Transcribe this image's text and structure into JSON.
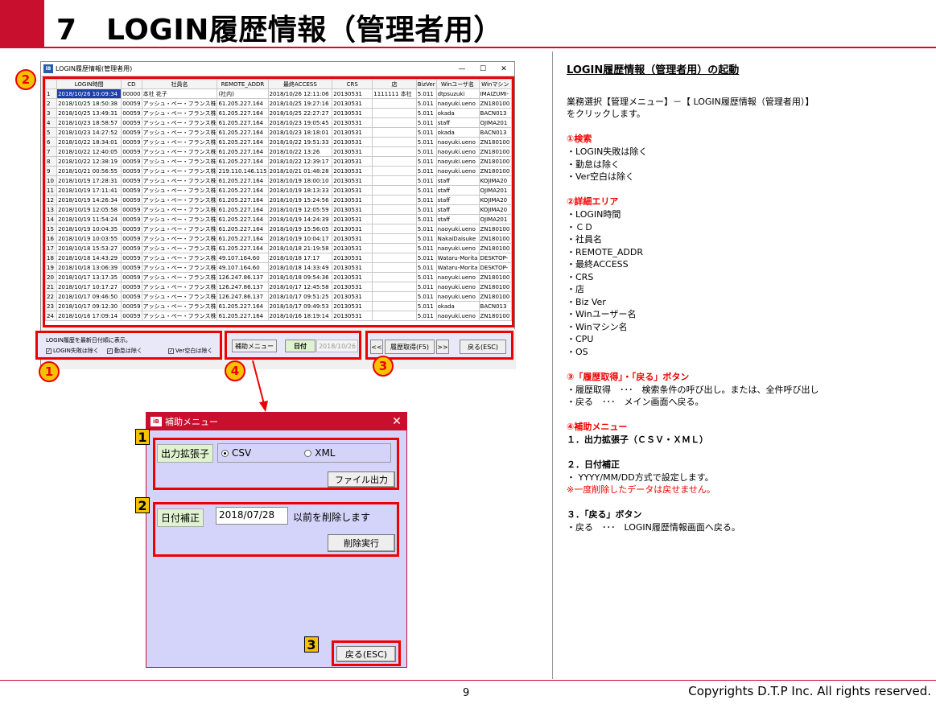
{
  "page": {
    "title": "7　LOGIN履歴情報（管理者用）",
    "page_number": "9",
    "copyright": "Copyrights  D.T.P Inc. All rights reserved."
  },
  "main_window": {
    "title": "LOGIN履歴情報(管理者用)",
    "columns": [
      "",
      "LOGIN時間",
      "CD",
      "社員名",
      "REMOTE_ADDR",
      "最終ACCESS",
      "CRS",
      "店",
      "BizVer",
      "Winユーザ名",
      "Winマシン"
    ],
    "rows": [
      [
        "1",
        "2018/10/26 10:09:34",
        "00000",
        "本社 花子",
        "(社内)",
        "2018/10/26 12:11:06",
        "20130531",
        "1111111 本社",
        "5.011",
        "dtpsuzuki",
        "IMAIZUMI-"
      ],
      [
        "2",
        "2018/10/25 18:50:38",
        "00059",
        "アッシュ・ペー・フランス株",
        "61.205.227.164",
        "2018/10/25 19:27:16",
        "20130531",
        "",
        "5.011",
        "naoyuki.ueno",
        "ZN180100"
      ],
      [
        "3",
        "2018/10/25 13:49:31",
        "00059",
        "アッシュ・ペー・フランス株",
        "61.205.227.164",
        "2018/10/25 22:27:27",
        "20130531",
        "",
        "5.011",
        "okada",
        "BACN013"
      ],
      [
        "4",
        "2018/10/23 18:58:57",
        "00059",
        "アッシュ・ペー・フランス株",
        "61.205.227.164",
        "2018/10/23 19:05:45",
        "20130531",
        "",
        "5.011",
        "staff",
        "OJIMA201"
      ],
      [
        "5",
        "2018/10/23 14:27:52",
        "00059",
        "アッシュ・ペー・フランス株",
        "61.205.227.164",
        "2018/10/23 18:18:01",
        "20130531",
        "",
        "5.011",
        "okada",
        "BACN013"
      ],
      [
        "6",
        "2018/10/22 18:34:01",
        "00059",
        "アッシュ・ペー・フランス株",
        "61.205.227.164",
        "2018/10/22 19:51:33",
        "20130531",
        "",
        "5.011",
        "naoyuki.ueno",
        "ZN180100"
      ],
      [
        "7",
        "2018/10/22 12:40:05",
        "00059",
        "アッシュ・ペー・フランス株",
        "61.205.227.164",
        "2018/10/22 13:26",
        "20130531",
        "",
        "5.011",
        "naoyuki.ueno",
        "ZN180100"
      ],
      [
        "8",
        "2018/10/22 12:38:19",
        "00059",
        "アッシュ・ペー・フランス株",
        "61.205.227.164",
        "2018/10/22 12:39:17",
        "20130531",
        "",
        "5.011",
        "naoyuki.ueno",
        "ZN180100"
      ],
      [
        "9",
        "2018/10/21 00:56:55",
        "00059",
        "アッシュ・ペー・フランス株",
        "219.110.146.115",
        "2018/10/21 01:48:28",
        "20130531",
        "",
        "5.011",
        "naoyuki.ueno",
        "ZN180100"
      ],
      [
        "10",
        "2018/10/19 17:28:31",
        "00059",
        "アッシュ・ペー・フランス株",
        "61.205.227.164",
        "2018/10/19 18:00:10",
        "20130531",
        "",
        "5.011",
        "staff",
        "KOJIMA20"
      ],
      [
        "11",
        "2018/10/19 17:11:41",
        "00059",
        "アッシュ・ペー・フランス株",
        "61.205.227.164",
        "2018/10/19 18:13:33",
        "20130531",
        "",
        "5.011",
        "staff",
        "OJIMA201"
      ],
      [
        "12",
        "2018/10/19 14:26:34",
        "00059",
        "アッシュ・ペー・フランス株",
        "61.205.227.164",
        "2018/10/19 15:24:56",
        "20130531",
        "",
        "5.011",
        "staff",
        "KOJIMA20"
      ],
      [
        "13",
        "2018/10/19 12:05:58",
        "00059",
        "アッシュ・ペー・フランス株",
        "61.205.227.164",
        "2018/10/19 12:05:59",
        "20130531",
        "",
        "5.011",
        "staff",
        "KOJIMA20"
      ],
      [
        "14",
        "2018/10/19 11:54:24",
        "00059",
        "アッシュ・ペー・フランス株",
        "61.205.227.164",
        "2018/10/19 14:24:39",
        "20130531",
        "",
        "5.011",
        "staff",
        "OJIMA201"
      ],
      [
        "15",
        "2018/10/19 10:04:35",
        "00059",
        "アッシュ・ペー・フランス株",
        "61.205.227.164",
        "2018/10/19 15:56:05",
        "20130531",
        "",
        "5.011",
        "naoyuki.ueno",
        "ZN180100"
      ],
      [
        "16",
        "2018/10/19 10:03:55",
        "00059",
        "アッシュ・ペー・フランス株",
        "61.205.227.164",
        "2018/10/19 10:04:17",
        "20130531",
        "",
        "5.011",
        "NakaiDaisuke",
        "ZN180100"
      ],
      [
        "17",
        "2018/10/18 15:53:27",
        "00059",
        "アッシュ・ペー・フランス株",
        "61.205.227.164",
        "2018/10/18 21:19:58",
        "20130531",
        "",
        "5.011",
        "naoyuki.ueno",
        "ZN180100"
      ],
      [
        "18",
        "2018/10/18 14:43:29",
        "00059",
        "アッシュ・ペー・フランス株",
        "49.107.164.60",
        "2018/10/18 17:17",
        "20130531",
        "",
        "5.011",
        "Wataru-Morita",
        "DESKTOP-"
      ],
      [
        "19",
        "2018/10/18 13:06:39",
        "00059",
        "アッシュ・ペー・フランス株",
        "49.107.164.60",
        "2018/10/18 14:33:49",
        "20130531",
        "",
        "5.011",
        "Wataru-Morita",
        "DESKTOP-"
      ],
      [
        "20",
        "2018/10/17 13:17:35",
        "00059",
        "アッシュ・ペー・フランス株",
        "126.247.86.137",
        "2018/10/18 09:54:36",
        "20130531",
        "",
        "5.011",
        "naoyuki.ueno",
        "ZN180100"
      ],
      [
        "21",
        "2018/10/17 10:17:27",
        "00059",
        "アッシュ・ペー・フランス株",
        "126.247.86.137",
        "2018/10/17 12:45:58",
        "20130531",
        "",
        "5.011",
        "naoyuki.ueno",
        "ZN180100"
      ],
      [
        "22",
        "2018/10/17 09:46:50",
        "00059",
        "アッシュ・ペー・フランス株",
        "126.247.86.137",
        "2018/10/17 09:51:25",
        "20130531",
        "",
        "5.011",
        "naoyuki.ueno",
        "ZN180100"
      ],
      [
        "23",
        "2018/10/17 09:12:30",
        "00059",
        "アッシュ・ペー・フランス株",
        "61.205.227.164",
        "2018/10/17 09:49:53",
        "20130531",
        "",
        "5.011",
        "okada",
        "BACN013"
      ],
      [
        "24",
        "2018/10/16 17:09:14",
        "00059",
        "アッシュ・ペー・フランス株",
        "61.205.227.164",
        "2018/10/16 18:19:14",
        "20130531",
        "",
        "5.011",
        "naoyuki.ueno",
        "ZN180100"
      ]
    ],
    "filter_caption": "LOGIN履歴を最新日付順に表示。",
    "filter_login_fail": "LOGIN失敗は除く",
    "filter_attendance": "勤怠は除く",
    "filter_ver_blank": "Ver空白は除く",
    "submenu_button": "補助メニュー",
    "date_button": "日付",
    "date_value": "2018/10/26",
    "prev_button": "<<",
    "fetch_button": "履歴取得(F5)",
    "next_button": ">>",
    "back_button": "戻る(ESC)"
  },
  "badges": {
    "b1": "1",
    "b2": "2",
    "b3": "3",
    "b4": "4"
  },
  "submenu_dialog": {
    "title": "補助メニュー",
    "tag1": "1",
    "tag2": "2",
    "tag3": "3",
    "ext_label": "出力拡張子",
    "opt_csv": "CSV",
    "opt_xml": "XML",
    "file_out_button": "ファイル出力",
    "date_label": "日付補正",
    "date_value": "2018/07/28",
    "date_suffix": "以前を削除します",
    "delete_button": "削除実行",
    "back_button": "戻る(ESC)"
  },
  "explanation": {
    "heading": "LOGIN履歴情報（管理者用）の起動",
    "intro1": "業務選択【管理メニュー】－【 LOGIN履歴情報（管理者用）】",
    "intro2": "をクリックします。",
    "s1_title": "①検索",
    "s1_items": [
      "・LOGIN失敗は除く",
      "・勤怠は除く",
      "・Ver空白は除く"
    ],
    "s2_title": "②詳細エリア",
    "s2_items": [
      "・LOGIN時間",
      "・ＣＤ",
      "・社員名",
      "・REMOTE_ADDR",
      "・最終ACCESS",
      "・CRS",
      "・店",
      "・Biz Ver",
      "・Winユーザー名",
      "・Winマシン名",
      "・CPU",
      "・OS"
    ],
    "s3_title": "③「履歴取得」・「戻る」ボタン",
    "s3_line1": "・履歴取得　･･･　検索条件の呼び出し。または、全件呼び出し",
    "s3_line2": "・戻る　･･･　メイン画面へ戻る。",
    "s4_title": "④補助メニュー",
    "s4_sub1": "１．出力拡張子（ＣＳＶ・ＸＭＬ）",
    "s4_sub2": "２．日付補正",
    "s4_sub2_line": "・ YYYY/MM/DD方式で設定します。",
    "s4_sub2_warn": "※一度削除したデータは戻せません。",
    "s4_sub3": "３．「戻る」ボタン",
    "s4_sub3_line": "・戻る　･･･　LOGIN履歴情報画面へ戻る。"
  },
  "colors": {
    "accent_red": "#c8102e",
    "selection_blue": "#1d3fa8",
    "badge_yellow": "#f6c200"
  }
}
